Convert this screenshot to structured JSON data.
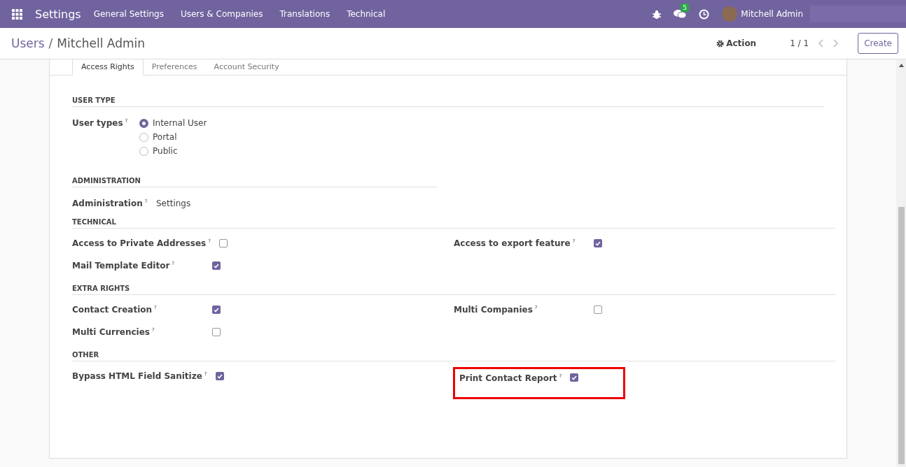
{
  "navbar": {
    "app": "Settings",
    "menus": [
      "General Settings",
      "Users & Companies",
      "Translations",
      "Technical"
    ],
    "messages_badge": "5",
    "user": "Mitchell Admin"
  },
  "control_panel": {
    "breadcrumb": [
      "Users",
      "Mitchell Admin"
    ],
    "separator": "/",
    "action": "Action",
    "pager": "1 / 1",
    "create": "Create"
  },
  "tabs": [
    {
      "label": "Access Rights",
      "selected": true
    },
    {
      "label": "Preferences",
      "selected": false
    },
    {
      "label": "Account Security",
      "selected": false
    }
  ],
  "user_type": {
    "title": "USER TYPE",
    "label": "User types",
    "help": "?",
    "options": [
      {
        "label": "Internal User",
        "selected": true
      },
      {
        "label": "Portal",
        "selected": false
      },
      {
        "label": "Public",
        "selected": false
      }
    ]
  },
  "administration": {
    "title": "ADMINISTRATION",
    "label": "Administration",
    "help": "?",
    "value": "Settings"
  },
  "groups": [
    {
      "title": "TECHNICAL",
      "rows": [
        [
          {
            "label": "Access to Private Addresses",
            "help": "?",
            "checked": false
          },
          {
            "label": "Access to export feature",
            "help": "?",
            "checked": true
          }
        ],
        [
          {
            "label": "Mail Template Editor",
            "help": "?",
            "checked": true
          }
        ]
      ]
    },
    {
      "title": "EXTRA RIGHTS",
      "rows": [
        [
          {
            "label": "Contact Creation",
            "help": "?",
            "checked": true
          },
          {
            "label": "Multi Companies",
            "help": "?",
            "checked": false
          }
        ],
        [
          {
            "label": "Multi Currencies",
            "help": "?",
            "checked": false
          }
        ]
      ]
    },
    {
      "title": "OTHER",
      "rows": [
        [
          {
            "label": "Bypass HTML Field Sanitize",
            "help": "?",
            "checked": true
          },
          {
            "label": "Print Contact Report",
            "help": "?",
            "checked": true,
            "highlighted": true
          }
        ]
      ]
    }
  ]
}
